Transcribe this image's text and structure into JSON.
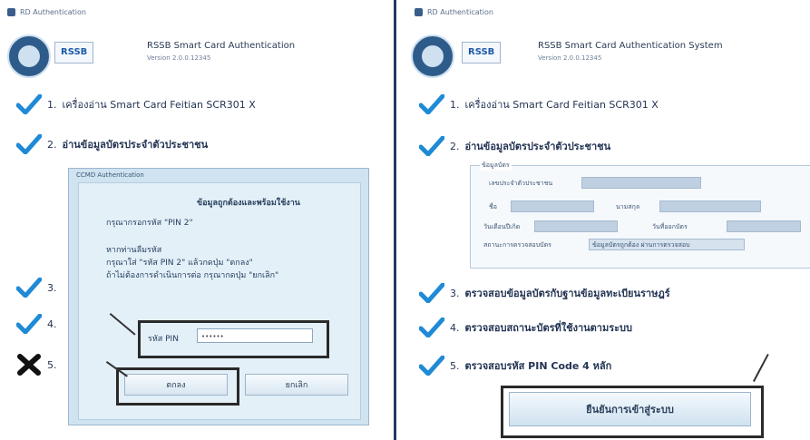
{
  "left": {
    "window_title": "RD Authentication",
    "logo_badge": "RSSB",
    "app_title": "RSSB Smart Card Authentication",
    "app_version": "Version 2.0.0.12345",
    "steps": [
      {
        "num": "1.",
        "text": "เครื่องอ่าน Smart Card  Feitian SCR301 X",
        "status": "check"
      },
      {
        "num": "2.",
        "text": "อ่านข้อมูลบัตรประจำตัวประชาชน",
        "status": "check"
      },
      {
        "num": "3.",
        "text": "",
        "status": "check"
      },
      {
        "num": "4.",
        "text": "",
        "status": "check"
      },
      {
        "num": "5.",
        "text": "",
        "status": "cross"
      }
    ],
    "dialog": {
      "title": "CCMD Authentication",
      "line1": "ข้อมูลถูกต้องและพร้อมใช้งาน",
      "line2": "กรุณากรอกรหัส \"PIN 2\"",
      "line3": "หากท่านลืมรหัส",
      "line4": "กรุณาใส่ \"รหัส PIN 2\" แล้วกดปุ่ม \"ตกลง\"",
      "line5": "ถ้าไม่ต้องการดำเนินการต่อ กรุณากดปุ่ม \"ยกเลิก\"",
      "pin_label": "รหัส PIN",
      "pin_value": "••••••",
      "ok_label": "ตกลง",
      "cancel_label": "ยกเลิก"
    }
  },
  "right": {
    "window_title": "RD Authentication",
    "logo_badge": "RSSB",
    "app_title": "RSSB Smart Card Authentication System",
    "app_version": "Version 2.0.0.12345",
    "steps": [
      {
        "num": "1.",
        "text": "เครื่องอ่าน Smart Card  Feitian SCR301 X"
      },
      {
        "num": "2.",
        "text": "อ่านข้อมูลบัตรประจำตัวประชาชน"
      },
      {
        "num": "3.",
        "text": "ตรวจสอบข้อมูลบัตรกับฐานข้อมูลทะเบียนราษฎร์"
      },
      {
        "num": "4.",
        "text": "ตรวจสอบสถานะบัตรที่ใช้งานตามระบบ"
      },
      {
        "num": "5.",
        "text": "ตรวจสอบรหัส PIN Code 4 หลัก"
      }
    ],
    "card_info": {
      "legend": "ข้อมูลบัตร",
      "row1_label": "เลขประจำตัวประชาชน",
      "row2_label": "ชื่อ",
      "row2_label_b": "นามสกุล",
      "row3_label": "วันเดือนปีเกิด",
      "row3_label_b": "วันที่ออกบัตร",
      "row4_label": "สถานะการตรวจสอบบัตร",
      "row4_value": "ข้อมูลบัตรถูกต้อง ผ่านการตรวจสอบ"
    },
    "confirm_label": "ยืนยันการเข้าสู่ระบบ"
  }
}
